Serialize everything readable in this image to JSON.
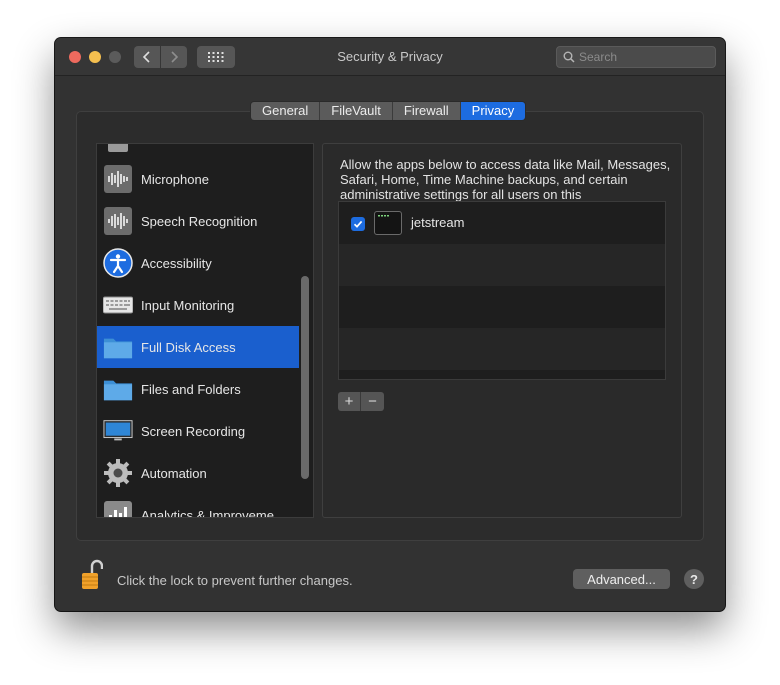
{
  "window": {
    "title": "Security & Privacy",
    "search_placeholder": "Search"
  },
  "tabs": [
    {
      "label": "General"
    },
    {
      "label": "FileVault"
    },
    {
      "label": "Firewall"
    },
    {
      "label": "Privacy",
      "active": true
    }
  ],
  "sidebar": {
    "items": [
      {
        "label": "Microphone",
        "icon": "microphone-waveform-icon"
      },
      {
        "label": "Speech Recognition",
        "icon": "speech-waveform-icon"
      },
      {
        "label": "Accessibility",
        "icon": "accessibility-icon"
      },
      {
        "label": "Input Monitoring",
        "icon": "keyboard-icon"
      },
      {
        "label": "Full Disk Access",
        "icon": "folder-icon",
        "selected": true
      },
      {
        "label": "Files and Folders",
        "icon": "folder-icon"
      },
      {
        "label": "Screen Recording",
        "icon": "display-icon"
      },
      {
        "label": "Automation",
        "icon": "gear-icon"
      },
      {
        "label": "Analytics & Improveme",
        "icon": "analytics-icon"
      }
    ]
  },
  "main": {
    "description": "Allow the apps below to access data like Mail, Messages, Safari, Home, Time Machine backups, and certain administrative settings for all users on this",
    "apps": [
      {
        "name": "jetstream",
        "checked": true
      }
    ],
    "add_label": "+",
    "remove_label": "−"
  },
  "footer": {
    "lock_text": "Click the lock to prevent further changes.",
    "advanced_label": "Advanced...",
    "help_label": "?"
  },
  "colors": {
    "accent": "#1d6ce0",
    "window_bg": "#323232",
    "list_bg": "#1e1e1e"
  }
}
